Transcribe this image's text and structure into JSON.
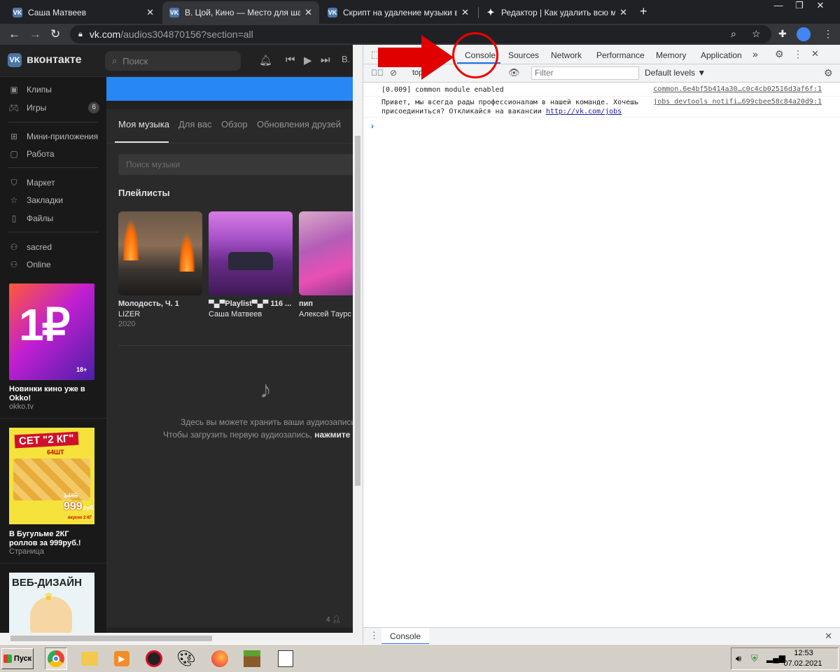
{
  "browser": {
    "tabs": [
      {
        "favicon": "VK",
        "title": "Саша Матвеев"
      },
      {
        "favicon": "VK",
        "title": "В. Цой, Кино — Место для шага вп"
      },
      {
        "favicon": "VK",
        "title": "Скрипт на удаление музыки вк"
      },
      {
        "favicon": "✦",
        "title": "Редактор | Как удалить всю музык"
      }
    ],
    "new_tab": "+",
    "url_host": "vk.com",
    "url_path": "/audios304870156?section=all"
  },
  "vk": {
    "logo": "VK",
    "brand": "вконтакте",
    "search_placeholder": "Поиск",
    "nav": [
      {
        "label": "Клипы",
        "icon": "clips-icon"
      },
      {
        "label": "Игры",
        "icon": "games-icon",
        "badge": "6"
      },
      {
        "label": "Мини-приложения",
        "icon": "apps-icon"
      },
      {
        "label": "Работа",
        "icon": "work-icon"
      },
      {
        "label": "Маркет",
        "icon": "market-icon"
      },
      {
        "label": "Закладки",
        "icon": "star-icon"
      },
      {
        "label": "Файлы",
        "icon": "file-icon"
      },
      {
        "label": "sacred",
        "icon": "group-icon"
      },
      {
        "label": "Online",
        "icon": "group-icon"
      }
    ],
    "ads": [
      {
        "image_text": "1₽",
        "age": "18+",
        "title": "Новинки кино уже в Okko!",
        "subtitle": "okko.tv"
      },
      {
        "image_text": "СЕТ \"2 КГ\"",
        "image_sub": "64ШТ",
        "image_price": "999",
        "image_currency": "руб.",
        "image_old": "1485",
        "image_weight": "вкусно 2 КГ",
        "title": "В Бугульме 2КГ роллов за 999руб.!",
        "subtitle": "Страница"
      },
      {
        "image_text": "ВЕБ-ДИЗАЙН"
      }
    ],
    "music_tabs": [
      "Моя музыка",
      "Для вас",
      "Обзор",
      "Обновления друзей"
    ],
    "music_search_placeholder": "Поиск музыки",
    "playlists_heading": "Плейлисты",
    "playlists": [
      {
        "title": "Молодость, Ч. 1",
        "artist": "LIZER",
        "year": "2020"
      },
      {
        "title": "▀▄▀Playlist▀▄▀ 116 ...",
        "artist": "Саша Матвеев",
        "year": ""
      },
      {
        "title": "пип",
        "artist": "Алексей Таурс",
        "year": ""
      }
    ],
    "empty_line1": "Здесь вы можете хранить ваши аудиозаписи",
    "empty_line2_prefix": "Чтобы загрузить первую аудиозапись, ",
    "empty_line2_link": "нажмите з",
    "friends_count": "4"
  },
  "devtools": {
    "tabs": [
      "Console",
      "Sources",
      "Network",
      "Performance",
      "Memory",
      "Application"
    ],
    "more": "»",
    "context": "top",
    "filter_placeholder": "Filter",
    "levels": "Default levels ▼",
    "console_lines": [
      {
        "message": "[0.009]  common module enabled",
        "source": "common.6e4bf5b414a30…c0c4cb02516d3af6f:1"
      },
      {
        "message_line1": "Привет, мы всегда рады профессионалам в нашей команде. Хочешь",
        "message_line2": "присоединиться? Откликайся на вакансии ",
        "link": "http://vk.com/jobs",
        "source": "jobs devtools notifi…699cbee58c84a20d9:1"
      }
    ],
    "prompt": "›",
    "drawer_tab": "Console"
  },
  "taskbar": {
    "start": "Пуск",
    "time": "12:53",
    "date": "07.02.2021"
  },
  "colors": {
    "vk_blue": "#4a76a8",
    "vk_bar": "#2787f5",
    "devtools_accent": "#1a73e8",
    "annotation_red": "#e00000"
  }
}
